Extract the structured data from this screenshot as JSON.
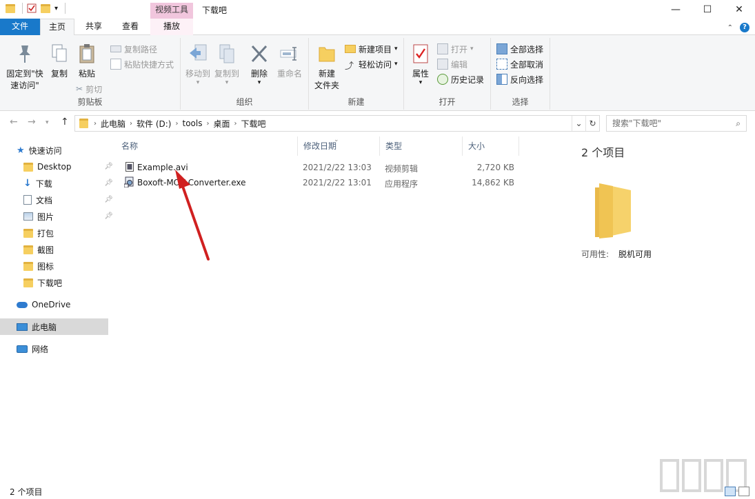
{
  "window": {
    "title": "下载吧",
    "context_tab_group": "视频工具"
  },
  "tabs": {
    "file": "文件",
    "home": "主页",
    "share": "共享",
    "view": "查看",
    "play": "播放"
  },
  "ribbon": {
    "clipboard": {
      "label": "剪贴板",
      "pin_quick": "固定到\"快\n速访问\"",
      "copy": "复制",
      "paste": "粘贴",
      "copy_path": "复制路径",
      "paste_shortcut": "粘贴快捷方式",
      "cut": "剪切"
    },
    "organize": {
      "label": "组织",
      "move_to": "移动到",
      "copy_to": "复制到",
      "delete": "删除",
      "rename": "重命名"
    },
    "new": {
      "label": "新建",
      "new_folder": "新建\n文件夹",
      "new_item": "新建项目",
      "easy_access": "轻松访问"
    },
    "open": {
      "label": "打开",
      "properties": "属性",
      "open": "打开",
      "edit": "编辑",
      "history": "历史记录"
    },
    "select": {
      "label": "选择",
      "select_all": "全部选择",
      "select_none": "全部取消",
      "invert": "反向选择"
    }
  },
  "address": {
    "crumbs": [
      "此电脑",
      "软件 (D:)",
      "tools",
      "桌面",
      "下载吧"
    ]
  },
  "search": {
    "placeholder": "搜索\"下载吧\""
  },
  "navpane": {
    "quick_access": "快速访问",
    "items": [
      "Desktop",
      "下载",
      "文档",
      "图片",
      "打包",
      "截图",
      "图标",
      "下载吧"
    ],
    "onedrive": "OneDrive",
    "this_pc": "此电脑",
    "network": "网络"
  },
  "columns": {
    "name": "名称",
    "modified": "修改日期",
    "type": "类型",
    "size": "大小"
  },
  "files": [
    {
      "name": "Example.avi",
      "modified": "2021/2/22 13:03",
      "type": "视频剪辑",
      "size": "2,720 KB"
    },
    {
      "name": "Boxoft-MOV-Converter.exe",
      "modified": "2021/2/22 13:01",
      "type": "应用程序",
      "size": "14,862 KB"
    }
  ],
  "details": {
    "count": "2 个项目",
    "availability_label": "可用性:",
    "availability_value": "脱机可用"
  },
  "status": {
    "count": "2 个项目"
  },
  "colors": {
    "accent": "#1979ca",
    "context_tab": "#f1c6dd",
    "folder": "#f6cf60",
    "arrow": "#d02020"
  }
}
